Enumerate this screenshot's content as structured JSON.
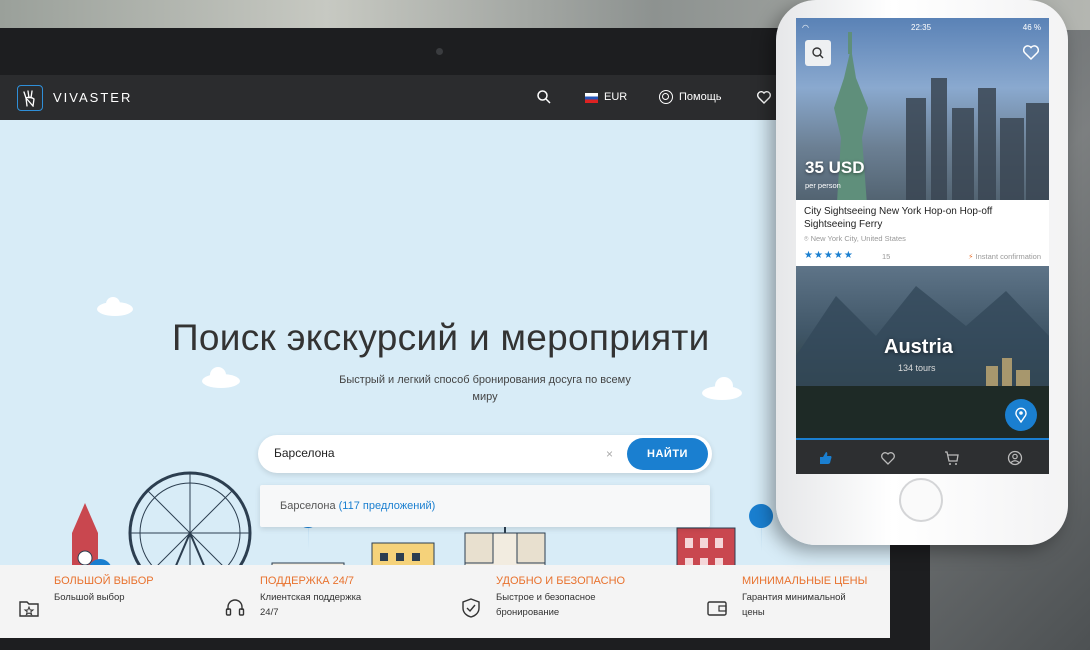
{
  "site": {
    "logo_text": "VIVASTER",
    "currency": "EUR",
    "help_label": "Помощь"
  },
  "hero": {
    "title": "Поиск экскурсий и мероприяти",
    "subtitle": "Быстрый и легкий способ бронирования досуга по всему миру"
  },
  "search": {
    "value": "Барселона",
    "button_label": "НАЙТИ",
    "clear_symbol": "×"
  },
  "suggestion": {
    "city": "Барселона",
    "count": "(117 предложений)"
  },
  "features": [
    {
      "title": "БОЛЬШОЙ ВЫБОР",
      "text": "Большой выбор",
      "icon": "folder-star-icon"
    },
    {
      "title": "ПОДДЕРЖКА 24/7",
      "text": "Клиентская поддержка 24/7",
      "icon": "headset-icon"
    },
    {
      "title": "УДОБНО И БЕЗОПАСНО",
      "text": "Быстрое и безопасное бронирование",
      "icon": "shield-check-icon"
    },
    {
      "title": "МИНИМАЛЬНЫЕ ЦЕНЫ",
      "text": "Гарантия минимальной цены",
      "icon": "wallet-icon"
    }
  ],
  "phone": {
    "status_time": "22:35",
    "status_battery": "46 %",
    "card": {
      "price": "35 USD",
      "per_person": "per person",
      "title": "City Sightseeing New York Hop-on Hop-off Sightseeing Ferry",
      "location": "New York City, United States",
      "stars": "★★★★★",
      "reviews": "15",
      "instant": "Instant confirmation"
    },
    "destination": {
      "title": "Austria",
      "tours": "134 tours"
    }
  },
  "colors": {
    "accent": "#1a7fd0",
    "feature_title": "#e8722e",
    "nav_bg": "#2b2c2e",
    "sky": "#d8ecf7"
  }
}
